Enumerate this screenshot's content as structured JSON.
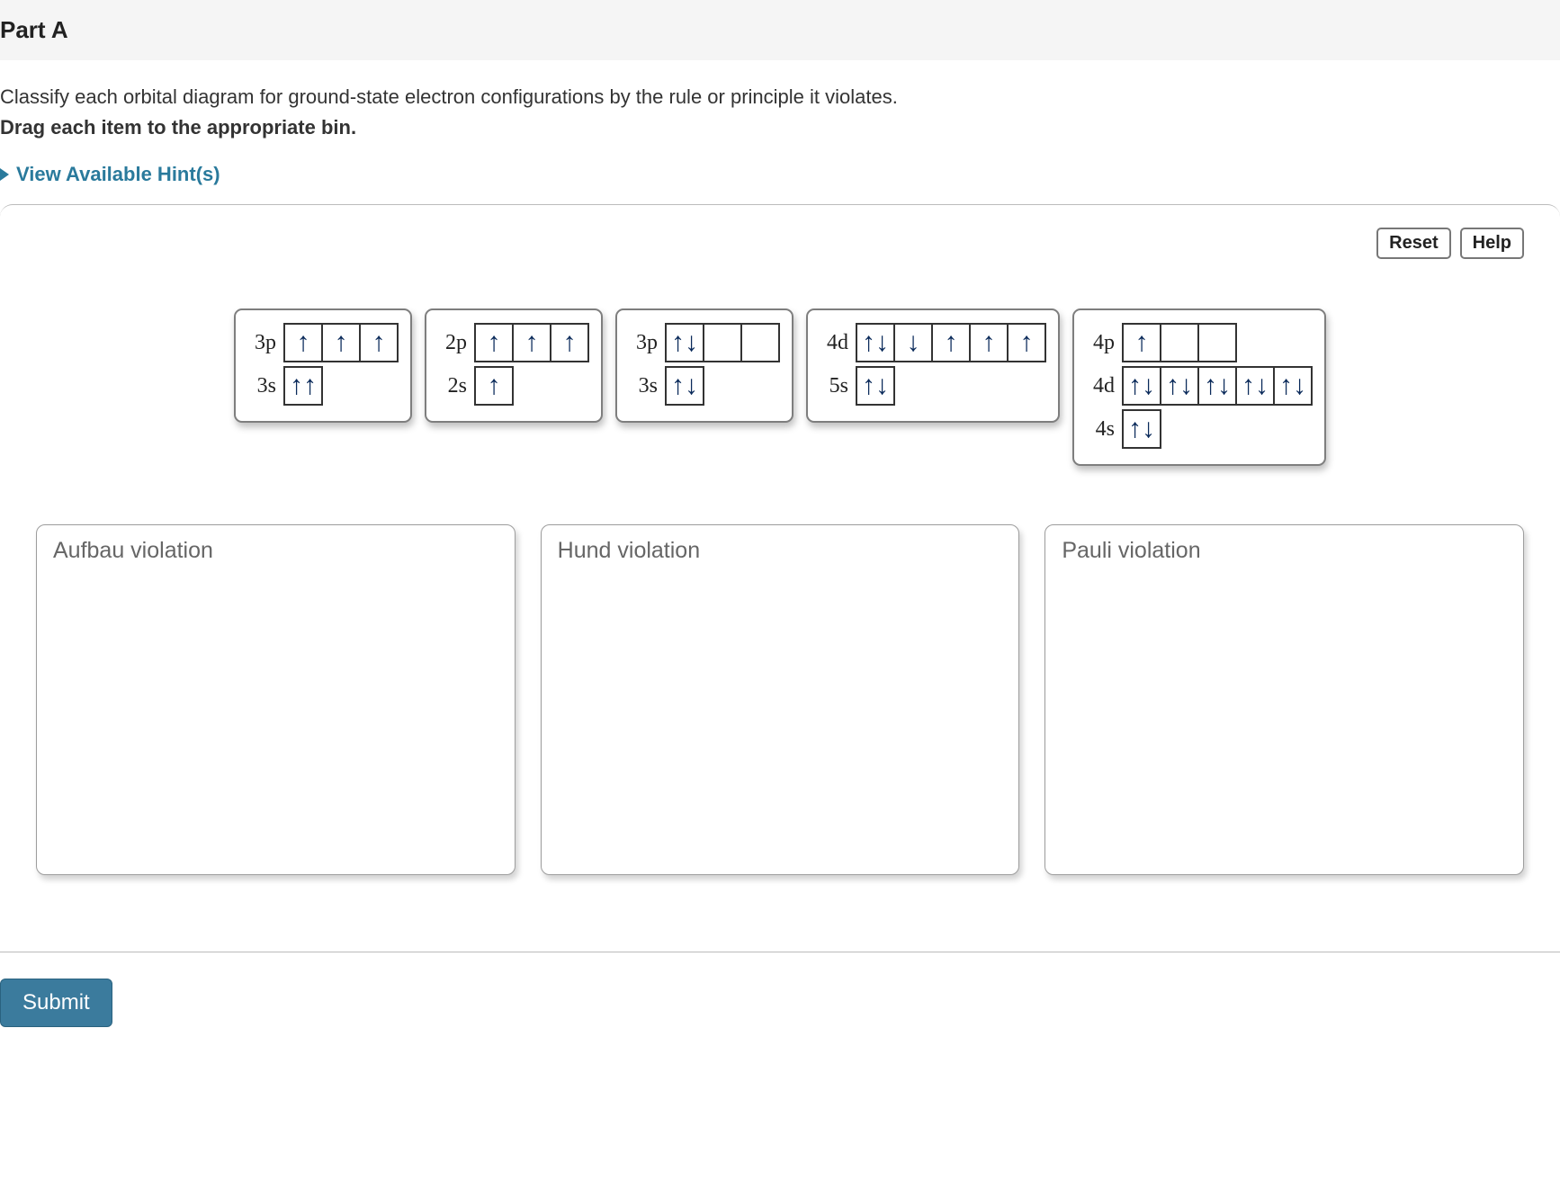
{
  "header": {
    "part_title": "Part A"
  },
  "instructions": {
    "line1": "Classify each orbital diagram for ground-state electron configurations by the rule or principle it violates.",
    "line2": "Drag each item to the appropriate bin."
  },
  "hints": {
    "label": "View Available Hint(s)"
  },
  "controls": {
    "reset": "Reset",
    "help": "Help"
  },
  "items": [
    {
      "subshells": [
        {
          "label": "3p",
          "boxes": [
            "↑",
            "↑",
            "↑"
          ]
        },
        {
          "label": "3s",
          "boxes": [
            "↑↑"
          ]
        }
      ]
    },
    {
      "subshells": [
        {
          "label": "2p",
          "boxes": [
            "↑",
            "↑",
            "↑"
          ]
        },
        {
          "label": "2s",
          "boxes": [
            "↑"
          ]
        }
      ]
    },
    {
      "subshells": [
        {
          "label": "3p",
          "boxes": [
            "↑↓",
            "",
            ""
          ]
        },
        {
          "label": "3s",
          "boxes": [
            "↑↓"
          ]
        }
      ]
    },
    {
      "subshells": [
        {
          "label": "4d",
          "boxes": [
            "↑↓",
            "↓",
            "↑",
            "↑",
            "↑"
          ]
        },
        {
          "label": "5s",
          "boxes": [
            "↑↓"
          ]
        }
      ]
    },
    {
      "subshells": [
        {
          "label": "4p",
          "boxes": [
            "↑",
            "",
            ""
          ]
        },
        {
          "label": "4d",
          "boxes": [
            "↑↓",
            "↑↓",
            "↑↓",
            "↑↓",
            "↑↓"
          ]
        },
        {
          "label": "4s",
          "boxes": [
            "↑↓"
          ]
        }
      ]
    }
  ],
  "bins": [
    {
      "title": "Aufbau violation"
    },
    {
      "title": "Hund violation"
    },
    {
      "title": "Pauli violation"
    }
  ],
  "submit": {
    "label": "Submit"
  }
}
